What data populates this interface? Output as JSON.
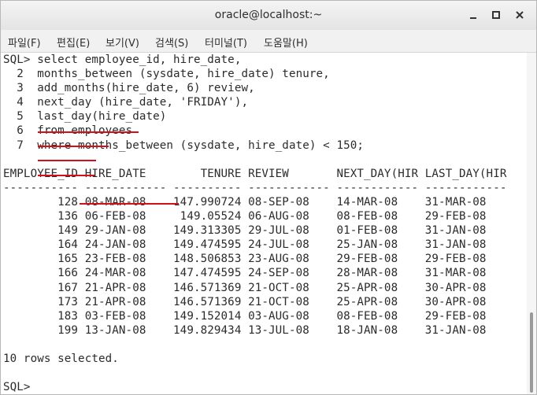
{
  "window": {
    "title": "oracle@localhost:~"
  },
  "menu": [
    "파일(F)",
    "편집(E)",
    "보기(V)",
    "검색(S)",
    "터미널(T)",
    "도움말(H)"
  ],
  "terminal": {
    "lines": [
      "SQL> select employee_id, hire_date,",
      "  2  months_between (sysdate, hire_date) tenure,",
      "  3  add_months(hire_date, 6) review,",
      "  4  next_day (hire_date, 'FRIDAY'),",
      "  5  last_day(hire_date)",
      "  6  from employees",
      "  7  where months_between (sysdate, hire_date) < 150;",
      "",
      "EMPLOYEE_ID HIRE_DATE        TENURE REVIEW       NEXT_DAY(HIR LAST_DAY(HIR",
      "----------- ------------ ---------- ------------ ------------ ------------",
      "        128 08-MAR-08    147.990724 08-SEP-08    14-MAR-08    31-MAR-08",
      "        136 06-FEB-08     149.05524 06-AUG-08    08-FEB-08    29-FEB-08",
      "        149 29-JAN-08    149.313305 29-JUL-08    01-FEB-08    31-JAN-08",
      "        164 24-JAN-08    149.474595 24-JUL-08    25-JAN-08    31-JAN-08",
      "        165 23-FEB-08    148.506853 23-AUG-08    29-FEB-08    29-FEB-08",
      "        166 24-MAR-08    147.474595 24-SEP-08    28-MAR-08    31-MAR-08",
      "        167 21-APR-08    146.571369 21-OCT-08    25-APR-08    30-APR-08",
      "        173 21-APR-08    146.571369 21-OCT-08    25-APR-08    30-APR-08",
      "        183 03-FEB-08    149.152014 03-AUG-08    08-FEB-08    29-FEB-08",
      "        199 13-JAN-08    149.829434 13-JUL-08    18-JAN-08    31-JAN-08",
      "",
      "10 rows selected.",
      "",
      "SQL> "
    ]
  },
  "colors": {
    "underline": "#d0101a",
    "text": "#2b2b2b"
  }
}
